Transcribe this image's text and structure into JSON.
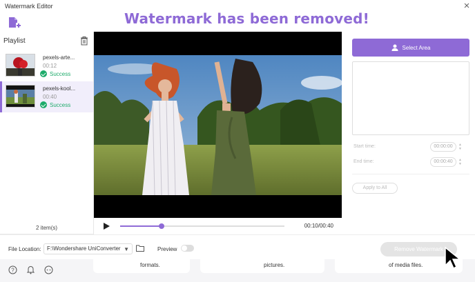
{
  "window": {
    "title": "Watermark Editor"
  },
  "banner": {
    "text": "Watermark has been removed!"
  },
  "sidebar": {
    "title": "Playlist",
    "items": [
      {
        "name": "pexels-arte...",
        "duration": "00:12",
        "status": "Success",
        "selected": false
      },
      {
        "name": "pexels-kool...",
        "duration": "00:40",
        "status": "Success",
        "selected": true
      }
    ],
    "count": "2 item(s)"
  },
  "player": {
    "time": "00:10/00:40",
    "progress": 0.25
  },
  "panel": {
    "select_area": "Select Area",
    "start_label": "Start time:",
    "start_value": "00:00:00",
    "end_label": "End time:",
    "end_value": "00:00:40",
    "apply_all": "Apply to All"
  },
  "footer": {
    "location_label": "File Location:",
    "location_value": "F:\\Wondershare UniConverter",
    "preview_label": "Preview",
    "remove_button": "Remove Watermark"
  },
  "background": {
    "texts": [
      "formats.",
      "pictures.",
      "of media files."
    ]
  },
  "colors": {
    "accent": "#8e6ad6",
    "success": "#1eab6b"
  }
}
